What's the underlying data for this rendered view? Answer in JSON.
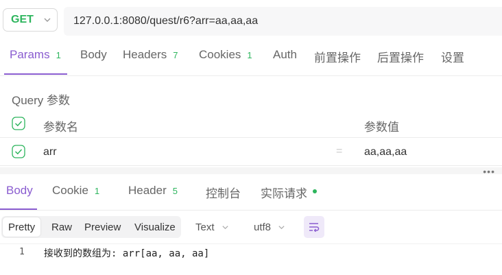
{
  "request": {
    "method": "GET",
    "url": "127.0.0.1:8080/quest/r6?arr=aa,aa,aa"
  },
  "request_tabs": [
    {
      "label": "Params",
      "count": "1"
    },
    {
      "label": "Body",
      "count": ""
    },
    {
      "label": "Headers",
      "count": "7"
    },
    {
      "label": "Cookies",
      "count": "1"
    },
    {
      "label": "Auth",
      "count": ""
    },
    {
      "label": "前置操作",
      "count": ""
    },
    {
      "label": "后置操作",
      "count": ""
    },
    {
      "label": "设置",
      "count": ""
    }
  ],
  "query": {
    "title": "Query 参数",
    "col_name": "参数名",
    "col_value": "参数值",
    "rows": [
      {
        "name": "arr",
        "eq": "=",
        "value": "aa,aa,aa"
      }
    ]
  },
  "splitter": {
    "dots": "•••"
  },
  "response_tabs": [
    {
      "label": "Body",
      "count": ""
    },
    {
      "label": "Cookie",
      "count": "1"
    },
    {
      "label": "Header",
      "count": "5"
    },
    {
      "label": "控制台",
      "count": ""
    },
    {
      "label": "实际请求",
      "count": ""
    }
  ],
  "view_modes": [
    "Pretty",
    "Raw",
    "Preview",
    "Visualize"
  ],
  "format_select": "Text",
  "encoding_select": "utf8",
  "code": {
    "line_number": "1",
    "line_text": "接收到的数组为: arr[aa, aa, aa]"
  },
  "colors": {
    "accent": "#8a5cd0",
    "green": "#2db55d"
  }
}
